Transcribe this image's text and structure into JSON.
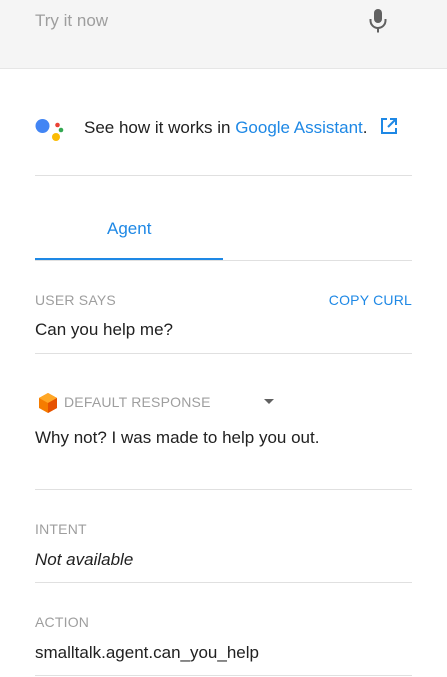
{
  "try_it": {
    "placeholder": "Try it now",
    "mic_icon": "microphone-icon"
  },
  "assistant": {
    "prefix": "See how it works in ",
    "link": "Google Assistant",
    "suffix": ".",
    "logo_icon": "google-assistant-logo-icon",
    "external_icon": "external-link-icon",
    "logo_colors": [
      "#4285F4",
      "#EA4335",
      "#FBBC05",
      "#34A853"
    ]
  },
  "tabs": [
    {
      "label": "Agent",
      "active": true
    }
  ],
  "user_says": {
    "label": "USER SAYS",
    "copy_curl": "COPY CURL",
    "value": "Can you help me?"
  },
  "response": {
    "label": "DEFAULT RESPONSE",
    "icon": "orange-cube-icon",
    "value": "Why not? I was made to help you out."
  },
  "intent": {
    "label": "INTENT",
    "value": "Not available"
  },
  "action": {
    "label": "ACTION",
    "value": "smalltalk.agent.can_you_help"
  },
  "colors": {
    "accent": "#1e88e5",
    "muted": "#9e9e9e",
    "divider": "#e0e0e0",
    "cube": "#f57c00"
  }
}
